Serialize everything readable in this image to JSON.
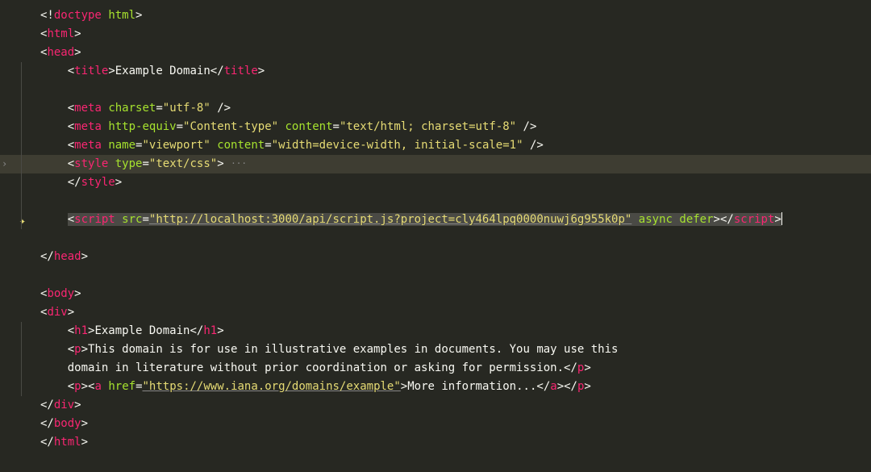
{
  "code": {
    "l1": {
      "open": "<!",
      "kw": "doctype",
      "sp": " ",
      "val": "html",
      "close": ">"
    },
    "l2": {
      "open": "<",
      "tag": "html",
      "close": ">"
    },
    "l3": {
      "open": "<",
      "tag": "head",
      "close": ">"
    },
    "l4": {
      "open": "<",
      "tag": "title",
      "close": ">",
      "text": "Example Domain",
      "open2": "</",
      "close2": ">"
    },
    "l6": {
      "open": "<",
      "tag": "meta",
      "sp": " ",
      "attr1": "charset",
      "eq": "=",
      "val1": "\"utf-8\"",
      "end": " />"
    },
    "l7": {
      "open": "<",
      "tag": "meta",
      "sp": " ",
      "attr1": "http-equiv",
      "eq": "=",
      "val1": "\"Content-type\"",
      "sp2": " ",
      "attr2": "content",
      "val2": "\"text/html; charset=utf-8\"",
      "end": " />"
    },
    "l8": {
      "open": "<",
      "tag": "meta",
      "sp": " ",
      "attr1": "name",
      "eq": "=",
      "val1": "\"viewport\"",
      "sp2": " ",
      "attr2": "content",
      "val2": "\"width=device-width, initial-scale=1\"",
      "end": " />"
    },
    "l9": {
      "open": "<",
      "tag": "style",
      "sp": " ",
      "attr1": "type",
      "eq": "=",
      "val1": "\"text/css\"",
      "close": ">",
      "fold": "···"
    },
    "l10": {
      "open": "</",
      "tag": "style",
      "close": ">"
    },
    "l12": {
      "open": "<",
      "tag": "script",
      "sp": " ",
      "attr1": "src",
      "eq": "=",
      "val1": "\"http://localhost:3000/api/script.js?project=cly464lpq0000nuwj6g955k0p\"",
      "sp2": " ",
      "attr2": "async",
      "sp3": " ",
      "attr3": "defer",
      "close": ">",
      "open2": "</",
      "close2": ">"
    },
    "l14": {
      "open": "</",
      "tag": "head",
      "close": ">"
    },
    "l16": {
      "open": "<",
      "tag": "body",
      "close": ">"
    },
    "l17": {
      "open": "<",
      "tag": "div",
      "close": ">"
    },
    "l18": {
      "open": "<",
      "tag": "h1",
      "close": ">",
      "text": "Example Domain",
      "open2": "</",
      "close2": ">"
    },
    "l19": {
      "open": "<",
      "tag": "p",
      "close": ">",
      "text": "This domain is for use in illustrative examples in documents. You may use this"
    },
    "l20": {
      "text": "domain in literature without prior coordination or asking for permission.",
      "open2": "</",
      "tag": "p",
      "close2": ">"
    },
    "l21": {
      "open": "<",
      "tag": "p",
      "close": ">",
      "open2": "<",
      "tag2": "a",
      "sp": " ",
      "attr1": "href",
      "eq": "=",
      "val1": "\"https://www.iana.org/domains/example\"",
      "close2": ">",
      "text": "More information...",
      "open3": "</",
      "close3": ">",
      "open4": "</",
      "close4": ">"
    },
    "l22": {
      "open": "</",
      "tag": "div",
      "close": ">"
    },
    "l23": {
      "open": "</",
      "tag": "body",
      "close": ">"
    },
    "l24": {
      "open": "</",
      "tag": "html",
      "close": ">"
    }
  },
  "gutter": {
    "fold": "›",
    "sparkle": "✦"
  }
}
